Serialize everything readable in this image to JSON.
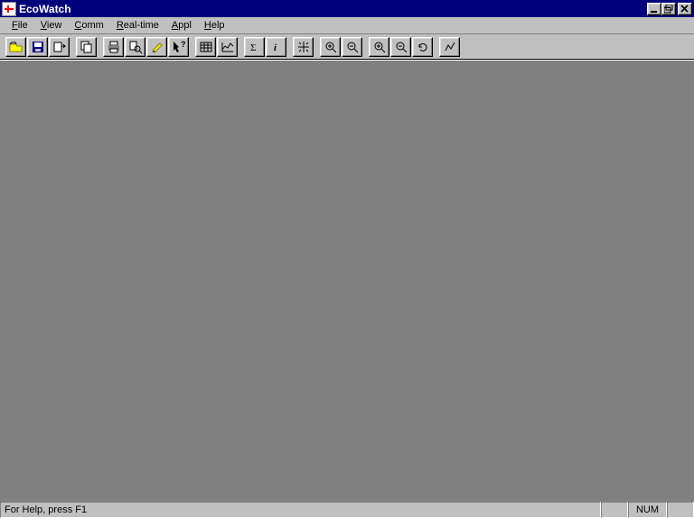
{
  "title": "EcoWatch",
  "menu": {
    "file": "File",
    "view": "View",
    "comm": "Comm",
    "realtime": "Real-time",
    "appl": "Appl",
    "help": "Help"
  },
  "toolbar": {
    "open": "open-icon",
    "save": "save-icon",
    "export": "export-icon",
    "copy": "copy-icon",
    "print": "print-icon",
    "printpreview": "print-preview-icon",
    "highlight": "highlight-icon",
    "contexthelp": "context-help-icon",
    "table": "table-icon",
    "graph": "graph-icon",
    "stats": "stats-icon",
    "info": "info-icon",
    "centerscale": "center-scale-icon",
    "zoomin": "zoom-in-icon",
    "zoomout": "zoom-out-icon",
    "zoomin2": "zoom-in-2-icon",
    "zoomout2": "zoom-out-2-icon",
    "refresh": "refresh-icon",
    "trace": "trace-icon"
  },
  "status": {
    "help": "For Help, press F1",
    "num": "NUM"
  }
}
